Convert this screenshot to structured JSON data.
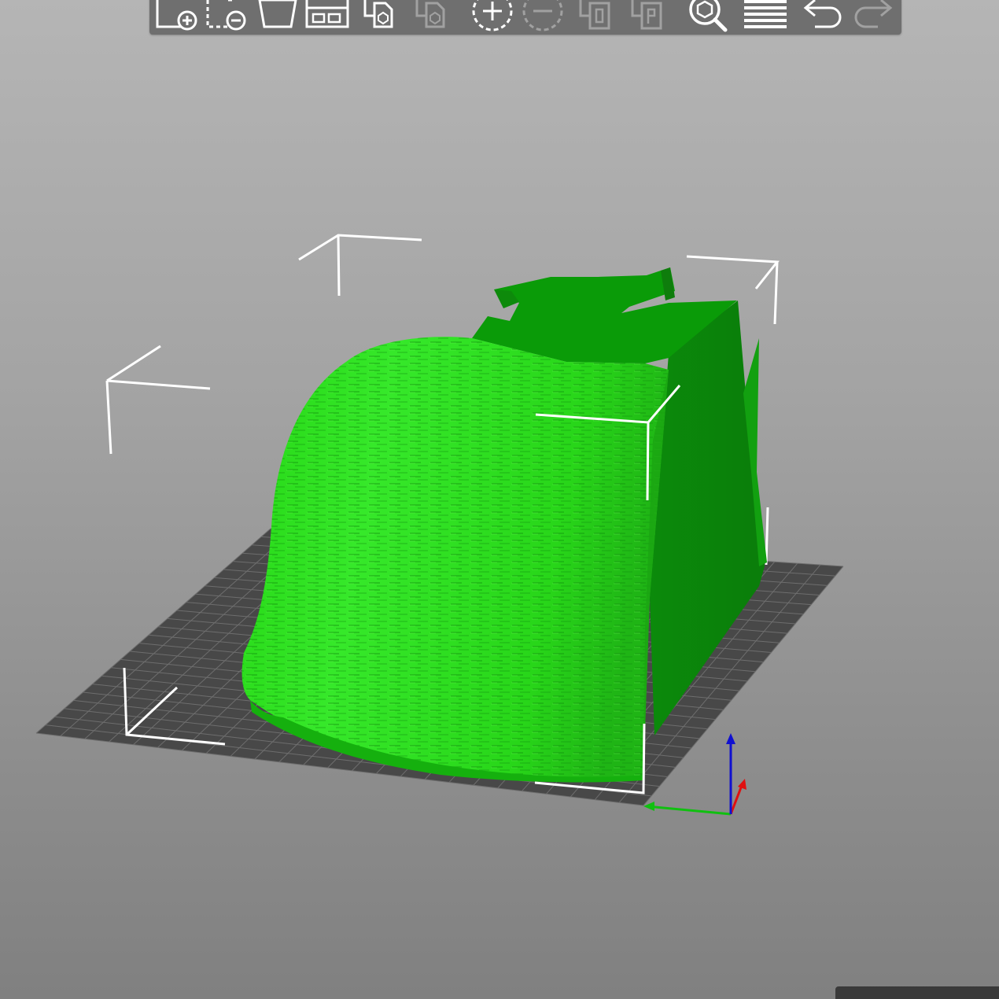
{
  "app": {
    "view": "3D"
  },
  "toolbar": {
    "items": [
      {
        "name": "add-button",
        "icon": "add-object-icon",
        "enabled": true
      },
      {
        "name": "delete-button",
        "icon": "delete-object-icon",
        "enabled": true
      },
      {
        "name": "delete-all-button",
        "icon": "delete-all-icon",
        "enabled": true
      },
      {
        "name": "arrange-button",
        "icon": "arrange-icon",
        "enabled": true
      },
      {
        "name": "copy-button",
        "icon": "copy-icon",
        "enabled": true
      },
      {
        "name": "paste-button",
        "icon": "paste-icon",
        "enabled": false
      },
      {
        "name": "add-instance-button",
        "icon": "add-instance-icon",
        "enabled": true
      },
      {
        "name": "remove-instance-button",
        "icon": "remove-instance-icon",
        "enabled": false
      },
      {
        "name": "split-to-objects-button",
        "icon": "split-objects-icon",
        "enabled": false
      },
      {
        "name": "split-to-parts-button",
        "icon": "split-parts-icon",
        "enabled": false
      },
      {
        "name": "search-button",
        "icon": "search-icon",
        "enabled": true
      },
      {
        "name": "layers-editing-button",
        "icon": "layers-icon",
        "enabled": true
      },
      {
        "name": "undo-button",
        "icon": "undo-icon",
        "enabled": true
      },
      {
        "name": "redo-button",
        "icon": "redo-icon",
        "enabled": false
      }
    ]
  },
  "colors": {
    "model_light": "#2ee11a",
    "model_mid": "#1ec50f",
    "model_dark": "#079607",
    "model_side": "#0a8a0a",
    "bed": "#484848",
    "bed_grid": "#6e6e6e",
    "bbox": "#ffffff",
    "axis_x": "#e01010",
    "axis_y": "#10c010",
    "axis_z": "#1010d0"
  }
}
